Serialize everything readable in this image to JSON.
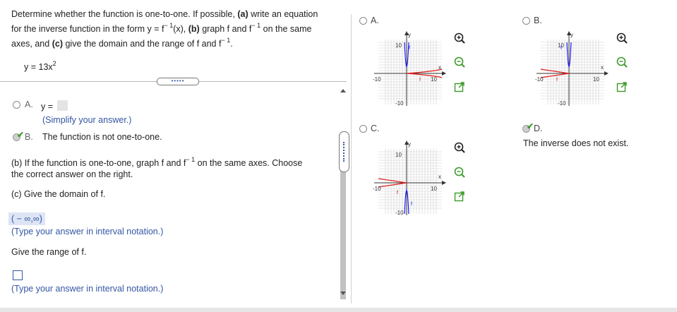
{
  "question": {
    "line1_pre": "Determine whether the function is one-to-one. If possible,",
    "line1_a": "(a)",
    "line1_post": "write an equation",
    "line2_pre": "for the inverse function in the form y = f",
    "line2_sup": "− 1",
    "line2_mid": "(x),",
    "line2_b": "(b)",
    "line2_mid2": "graph f and f",
    "line2_sup2": "− 1",
    "line2_post": "on the same",
    "line3_pre": "axes, and",
    "line3_c": "(c)",
    "line3_mid": "give the domain and the range of f and f",
    "line3_sup": "− 1",
    "line3_post": ".",
    "function_pre": "y = 13x",
    "function_sup": "2"
  },
  "divider_handle": "•••••",
  "part_a": {
    "option_a_letter": "A.",
    "option_a_text": "y =",
    "simplify_hint": "(Simplify your answer.)",
    "option_b_letter": "B.",
    "option_b_text": "The function is not one-to-one."
  },
  "part_b": {
    "line1_pre": "(b) If the function is one-to-one, graph f and f",
    "line1_sup": "− 1",
    "line1_post": "on the same axes. Choose",
    "line2": "the correct answer on the right."
  },
  "part_c": {
    "domain_prompt": "(c) Give the domain of f.",
    "domain_answer": "( − ∞,∞)",
    "domain_hint": "(Type your answer in interval notation.)",
    "range_prompt": "Give the range of f.",
    "range_hint": "(Type your answer in interval notation.)"
  },
  "graph_options": {
    "a_label": "A.",
    "b_label": "B.",
    "c_label": "C.",
    "d_label": "D.",
    "d_text": "The inverse does not exist.",
    "axis_y": "y",
    "axis_x": "x",
    "tick_pos": "10",
    "tick_neg": "-10",
    "curve_f": "f",
    "curve_finv": "f"
  },
  "icons": [
    "zoom-in-icon",
    "zoom-out-icon",
    "expand-icon"
  ],
  "colors": {
    "accent": "#3456a4",
    "check": "#3c9a2a",
    "curve_red": "#e02020",
    "curve_blue": "#1a1aff"
  }
}
